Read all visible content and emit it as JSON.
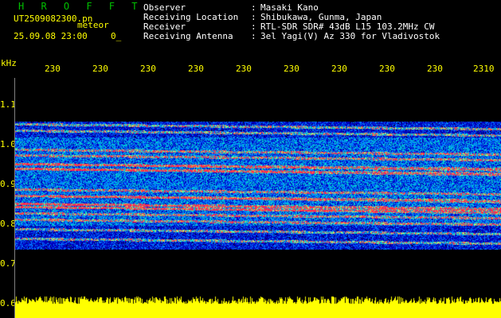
{
  "header": {
    "title": "H R O F F T",
    "file_name": "UT2509082300.pn",
    "meteor_label": "meteor",
    "date_time": "25.09.08 23:00",
    "count": "0_"
  },
  "meta": [
    {
      "label": "Observer",
      "value": "Masaki Kano"
    },
    {
      "label": "Receiving Location",
      "value": "Shibukawa, Gunma, Japan"
    },
    {
      "label": "Receiver",
      "value": "RTL-SDR SDR# 43dB L15 103.2MHz CW"
    },
    {
      "label": "Receiving Antenna",
      "value": "3el Yagi(V) Az 330 for Vladivostok"
    }
  ],
  "meta_separator": ":",
  "axis": {
    "unit": "kHz",
    "time_ticks": [
      "230",
      "230",
      "230",
      "230",
      "230",
      "230",
      "230",
      "230",
      "230",
      "2310"
    ],
    "freq_ticks": [
      "1.1",
      "1.0",
      "0.9",
      "0.8",
      "0.7",
      "0.6"
    ]
  },
  "colors": {
    "background": "#000000",
    "text": "#ffff00",
    "title": "#00c000",
    "baseline_bar": "#ffff00"
  }
}
